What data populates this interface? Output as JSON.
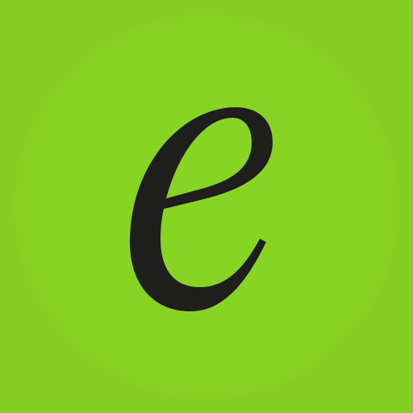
{
  "app_icon": {
    "glyph": "e",
    "icon_name": "italic-serif-letter-e-icon",
    "colors": {
      "background": "#87d322",
      "glyph": "#1e1e1c"
    }
  }
}
